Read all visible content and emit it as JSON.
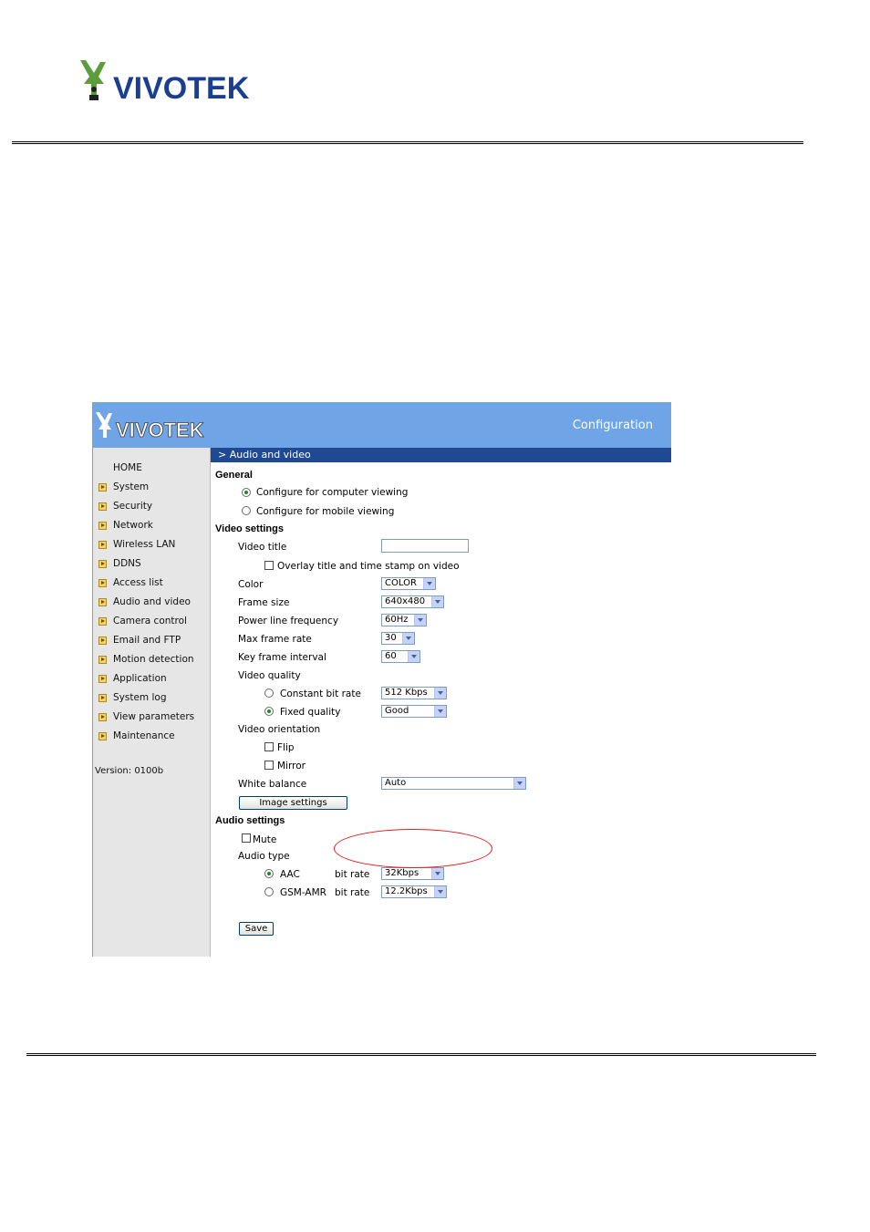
{
  "document": {
    "logo_text": "VIVOTEK"
  },
  "banner": {
    "logo_text": "VIVOTEK",
    "title": "Configuration"
  },
  "sidebar": {
    "items": [
      {
        "label": "HOME",
        "arrow": false
      },
      {
        "label": "System",
        "arrow": true
      },
      {
        "label": "Security",
        "arrow": true
      },
      {
        "label": "Network",
        "arrow": true
      },
      {
        "label": "Wireless LAN",
        "arrow": true
      },
      {
        "label": "DDNS",
        "arrow": true
      },
      {
        "label": "Access list",
        "arrow": true
      },
      {
        "label": "Audio and video",
        "arrow": true
      },
      {
        "label": "Camera control",
        "arrow": true
      },
      {
        "label": "Email and FTP",
        "arrow": true
      },
      {
        "label": "Motion detection",
        "arrow": true
      },
      {
        "label": "Application",
        "arrow": true
      },
      {
        "label": "System log",
        "arrow": true
      },
      {
        "label": "View parameters",
        "arrow": true
      },
      {
        "label": "Maintenance",
        "arrow": true
      }
    ],
    "version": "Version: 0100b"
  },
  "main": {
    "section_title": "> Audio and video",
    "general": {
      "heading": "General",
      "option_computer": "Configure for computer viewing",
      "option_mobile": "Configure for mobile viewing",
      "selected": "computer"
    },
    "video": {
      "heading": "Video settings",
      "title_label": "Video title",
      "title_value": "",
      "overlay_label": "Overlay title and time stamp on video",
      "overlay_checked": false,
      "color_label": "Color",
      "color_value": "COLOR",
      "frame_size_label": "Frame size",
      "frame_size_value": "640x480",
      "power_line_label": "Power line frequency",
      "power_line_value": "60Hz",
      "max_frame_rate_label": "Max frame rate",
      "max_frame_rate_value": "30",
      "key_frame_label": "Key frame interval",
      "key_frame_value": "60",
      "quality_label": "Video quality",
      "cbr_label": "Constant bit rate",
      "cbr_value": "512 Kbps",
      "fixed_label": "Fixed quality",
      "fixed_value": "Good",
      "quality_selected": "fixed",
      "orientation_label": "Video orientation",
      "flip_label": "Flip",
      "mirror_label": "Mirror",
      "white_balance_label": "White balance",
      "white_balance_value": "Auto",
      "image_settings_button": "Image settings"
    },
    "audio": {
      "heading": "Audio settings",
      "mute_label": "Mute",
      "type_label": "Audio type",
      "aac_label": "AAC",
      "aac_bitrate_label": "bit rate",
      "aac_bitrate_value": "32Kbps",
      "gsm_label": "GSM-AMR",
      "gsm_bitrate_label": "bit rate",
      "gsm_bitrate_value": "12.2Kbps",
      "selected": "aac"
    },
    "save_button": "Save"
  },
  "colors": {
    "banner": "#6fa5e6",
    "section_bar": "#1f4a93",
    "sidebar": "#e6e6e6",
    "highlight_ellipse": "#e51d1d"
  }
}
